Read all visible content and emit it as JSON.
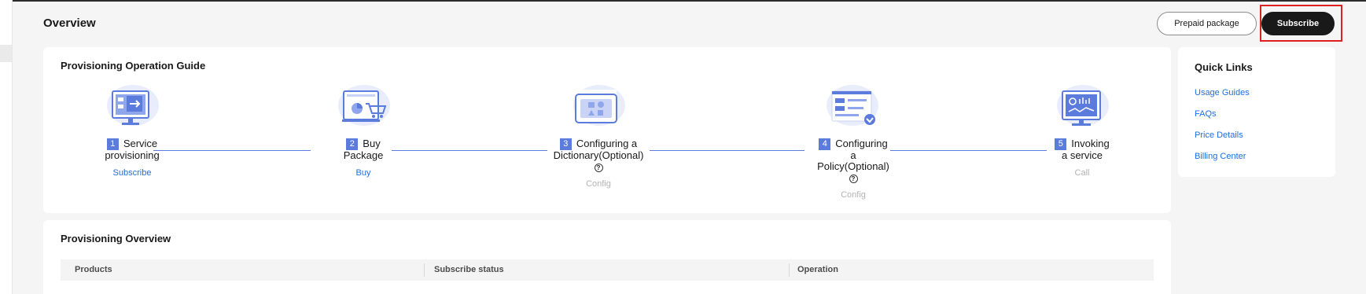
{
  "header": {
    "title": "Overview",
    "prepaid_label": "Prepaid package",
    "subscribe_label": "Subscribe"
  },
  "guide": {
    "title": "Provisioning Operation Guide",
    "steps": [
      {
        "num": "1",
        "title_l1": "Service",
        "title_l2": "provisioning",
        "title_l3": "",
        "has_help": false,
        "sub": "Subscribe",
        "sub_active": true,
        "icon": "monitor-arrow-icon"
      },
      {
        "num": "2",
        "title_l1": "Buy",
        "title_l2": "Package",
        "title_l3": "",
        "has_help": false,
        "sub": "Buy",
        "sub_active": true,
        "icon": "cart-icon"
      },
      {
        "num": "3",
        "title_l1": "Configuring a",
        "title_l2": "Dictionary(Optional)",
        "title_l3": "",
        "has_help": true,
        "sub": "Config",
        "sub_active": false,
        "icon": "dictionary-icon"
      },
      {
        "num": "4",
        "title_l1": "Configuring",
        "title_l2": "a",
        "title_l3": "Policy(Optional)",
        "has_help": true,
        "sub": "Config",
        "sub_active": false,
        "icon": "policy-icon"
      },
      {
        "num": "5",
        "title_l1": "Invoking",
        "title_l2": "a service",
        "title_l3": "",
        "has_help": false,
        "sub": "Call",
        "sub_active": false,
        "icon": "dashboard-monitor-icon"
      }
    ],
    "help_glyph": "?"
  },
  "overview": {
    "title": "Provisioning Overview",
    "columns": [
      "Products",
      "Subscribe status",
      "Operation"
    ]
  },
  "quick_links": {
    "title": "Quick Links",
    "items": [
      "Usage Guides",
      "FAQs",
      "Price Details",
      "Billing Center"
    ]
  },
  "colors": {
    "accent": "#5b7cdc",
    "link": "#1e6fe0",
    "primary_button": "#191919",
    "highlight": "#e02020"
  }
}
